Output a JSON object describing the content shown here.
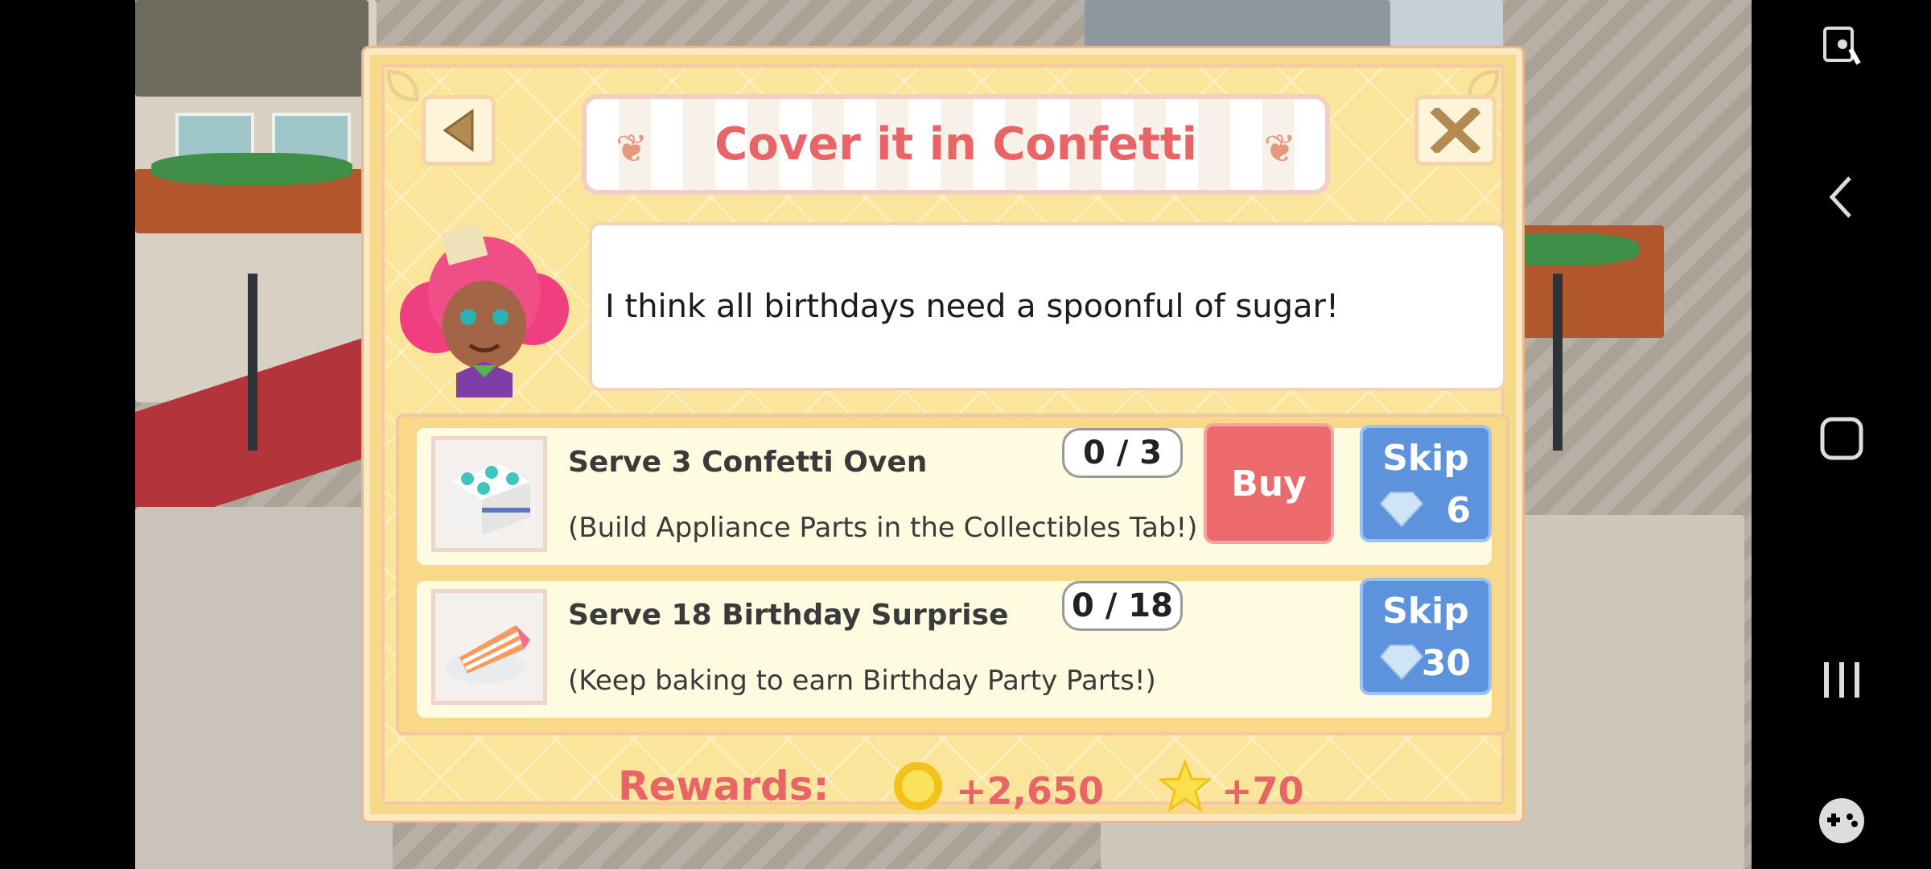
{
  "dialog": {
    "title": "Cover it in Confetti",
    "back_icon": "back-arrow-icon",
    "close_icon": "close-x-icon",
    "message": "I think all birthdays need a spoonful of sugar!",
    "tasks": [
      {
        "title": "Serve 3 Confetti Oven",
        "subtitle": "(Build Appliance Parts in the Collectibles Tab!)",
        "progress": "0 / 3",
        "buy_label": "Buy",
        "skip_label": "Skip",
        "skip_cost": "6"
      },
      {
        "title": "Serve 18 Birthday Surprise",
        "subtitle": "(Keep baking to earn Birthday Party Parts!)",
        "progress": "0 / 18",
        "skip_label": "Skip",
        "skip_cost": "30"
      }
    ],
    "rewards": {
      "label": "Rewards:",
      "coins": "+2,650",
      "stars": "+70"
    }
  },
  "colors": {
    "title": "#e86466",
    "buy": "#ec6a6b",
    "skip": "#5d92dc",
    "panel": "#fbe59a"
  },
  "navbar": {
    "icons": [
      "screen-lock-icon",
      "back-icon",
      "home-icon",
      "recents-icon",
      "game-tools-icon"
    ]
  }
}
